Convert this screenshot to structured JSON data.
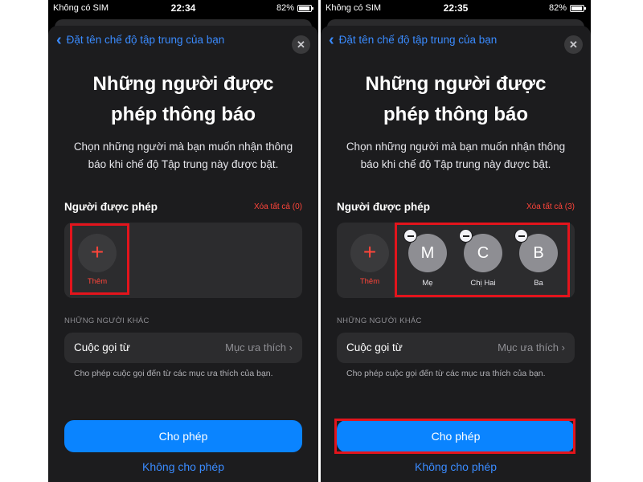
{
  "colors": {
    "accent_blue": "#0a84ff",
    "danger_red": "#ff453a",
    "sheet_bg": "#1c1c1e",
    "highlight_red": "#e3141c"
  },
  "screens": [
    {
      "status": {
        "carrier": "Không có SIM",
        "time": "22:34",
        "battery": "82%",
        "battery_level": 0.82
      },
      "nav": {
        "back_label": "Đặt tên chế độ tập trung của bạn",
        "back_icon": "chevron-left-icon",
        "close_icon": "close-icon"
      },
      "title_line1": "Những người được",
      "title_line2": "phép thông báo",
      "subtitle_line1": "Chọn những người mà bạn muốn nhận thông",
      "subtitle_line2": "báo khi chế độ Tập trung này được bật.",
      "allowed_section": {
        "heading": "Người được phép",
        "clear_all": "Xóa tất cả (0)"
      },
      "add_button": {
        "icon": "plus-icon",
        "label": "Thêm"
      },
      "contacts": [],
      "other_section": {
        "heading": "NHỮNG NGƯỜI KHÁC",
        "calls_label": "Cuộc gọi từ",
        "calls_value": "Mục ưa thích",
        "footnote": "Cho phép cuộc gọi đến từ các mục ưa thích của bạn."
      },
      "allow_button": "Cho phép",
      "deny_button": "Không cho phép"
    },
    {
      "status": {
        "carrier": "Không có SIM",
        "time": "22:35",
        "battery": "82%",
        "battery_level": 0.82
      },
      "nav": {
        "back_label": "Đặt tên chế độ tập trung của bạn",
        "back_icon": "chevron-left-icon",
        "close_icon": "close-icon"
      },
      "title_line1": "Những người được",
      "title_line2": "phép thông báo",
      "subtitle_line1": "Chọn những người mà bạn muốn nhận thông",
      "subtitle_line2": "báo khi chế độ Tập trung này được bật.",
      "allowed_section": {
        "heading": "Người được phép",
        "clear_all": "Xóa tất cả (3)"
      },
      "add_button": {
        "icon": "plus-icon",
        "label": "Thêm"
      },
      "contacts": [
        {
          "initial": "M",
          "name": "Mẹ"
        },
        {
          "initial": "C",
          "name": "Chị Hai"
        },
        {
          "initial": "B",
          "name": "Ba"
        }
      ],
      "other_section": {
        "heading": "NHỮNG NGƯỜI KHÁC",
        "calls_label": "Cuộc gọi từ",
        "calls_value": "Mục ưa thích",
        "footnote": "Cho phép cuộc gọi đến từ các mục ưa thích của bạn."
      },
      "allow_button": "Cho phép",
      "deny_button": "Không cho phép"
    }
  ]
}
